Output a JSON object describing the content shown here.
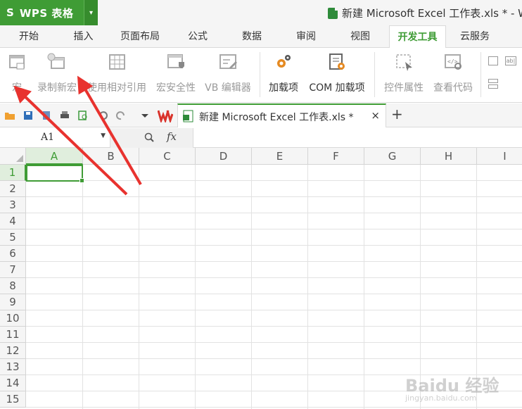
{
  "app": {
    "logo_letter": "S",
    "name": "WPS 表格",
    "dropdown": "▾"
  },
  "document": {
    "title": "新建 Microsoft Excel 工作表.xls * - W"
  },
  "tabs": [
    {
      "label": "开始"
    },
    {
      "label": "插入"
    },
    {
      "label": "页面布局"
    },
    {
      "label": "公式"
    },
    {
      "label": "数据"
    },
    {
      "label": "审阅"
    },
    {
      "label": "视图"
    },
    {
      "label": "开发工具",
      "active": true
    },
    {
      "label": "云服务"
    }
  ],
  "ribbon": {
    "macro": "宏",
    "record_macro": "录制新宏",
    "relative_ref": "使用相对引用",
    "macro_security": "宏安全性",
    "vb_editor": "VB 编辑器",
    "addins": "加载项",
    "com_addins": "COM 加载项",
    "control_props": "控件属性",
    "view_code": "查看代码"
  },
  "doc_tab": {
    "label": "新建 Microsoft Excel 工作表.xls *",
    "close": "×",
    "new_tab": "+"
  },
  "formula_bar": {
    "cell_ref": "A1",
    "zoom_icon": "🔍",
    "fx": "fx",
    "value": ""
  },
  "columns": [
    "A",
    "B",
    "C",
    "D",
    "E",
    "F",
    "G",
    "H",
    "I"
  ],
  "rows": [
    "1",
    "2",
    "3",
    "4",
    "5",
    "6",
    "7",
    "8",
    "9",
    "10",
    "11",
    "12",
    "13",
    "14",
    "15"
  ],
  "active_cell": "A1",
  "colors": {
    "accent": "#3f9c35",
    "arrow": "#e8322e"
  },
  "watermark": {
    "brand": "Baidu 经验",
    "url": "jingyan.baidu.com"
  }
}
